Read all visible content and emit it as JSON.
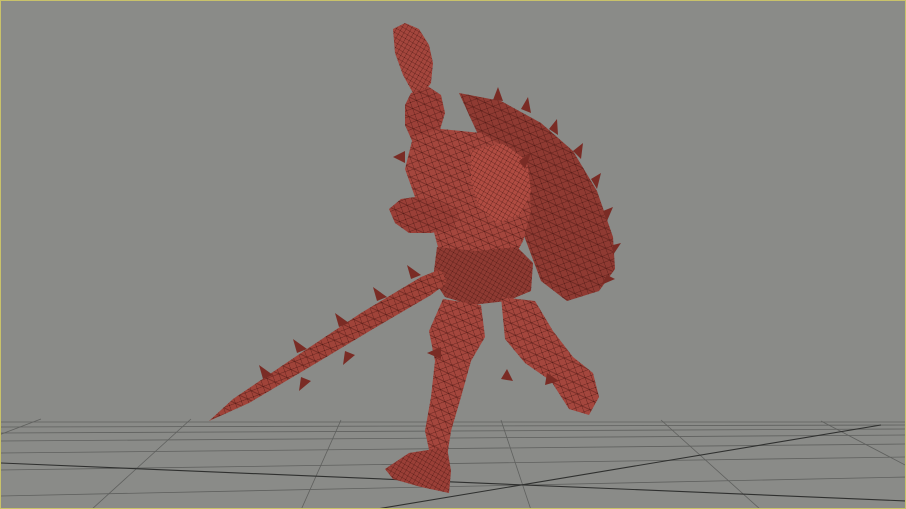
{
  "viewport": {
    "background_color": "#8a8b88",
    "border_color": "#c9c26a",
    "grid_line_color": "#5f605e",
    "grid_axis_color": "#2f302f",
    "model_fill_color": "#a4463d",
    "model_dark_color": "#6e2620",
    "model_wire_color": "#4a1612"
  },
  "scene": {
    "model": "armored-warrior-with-sword-and-shield",
    "display_mode": "wireframe-on-shaded",
    "ground_grid": true
  }
}
